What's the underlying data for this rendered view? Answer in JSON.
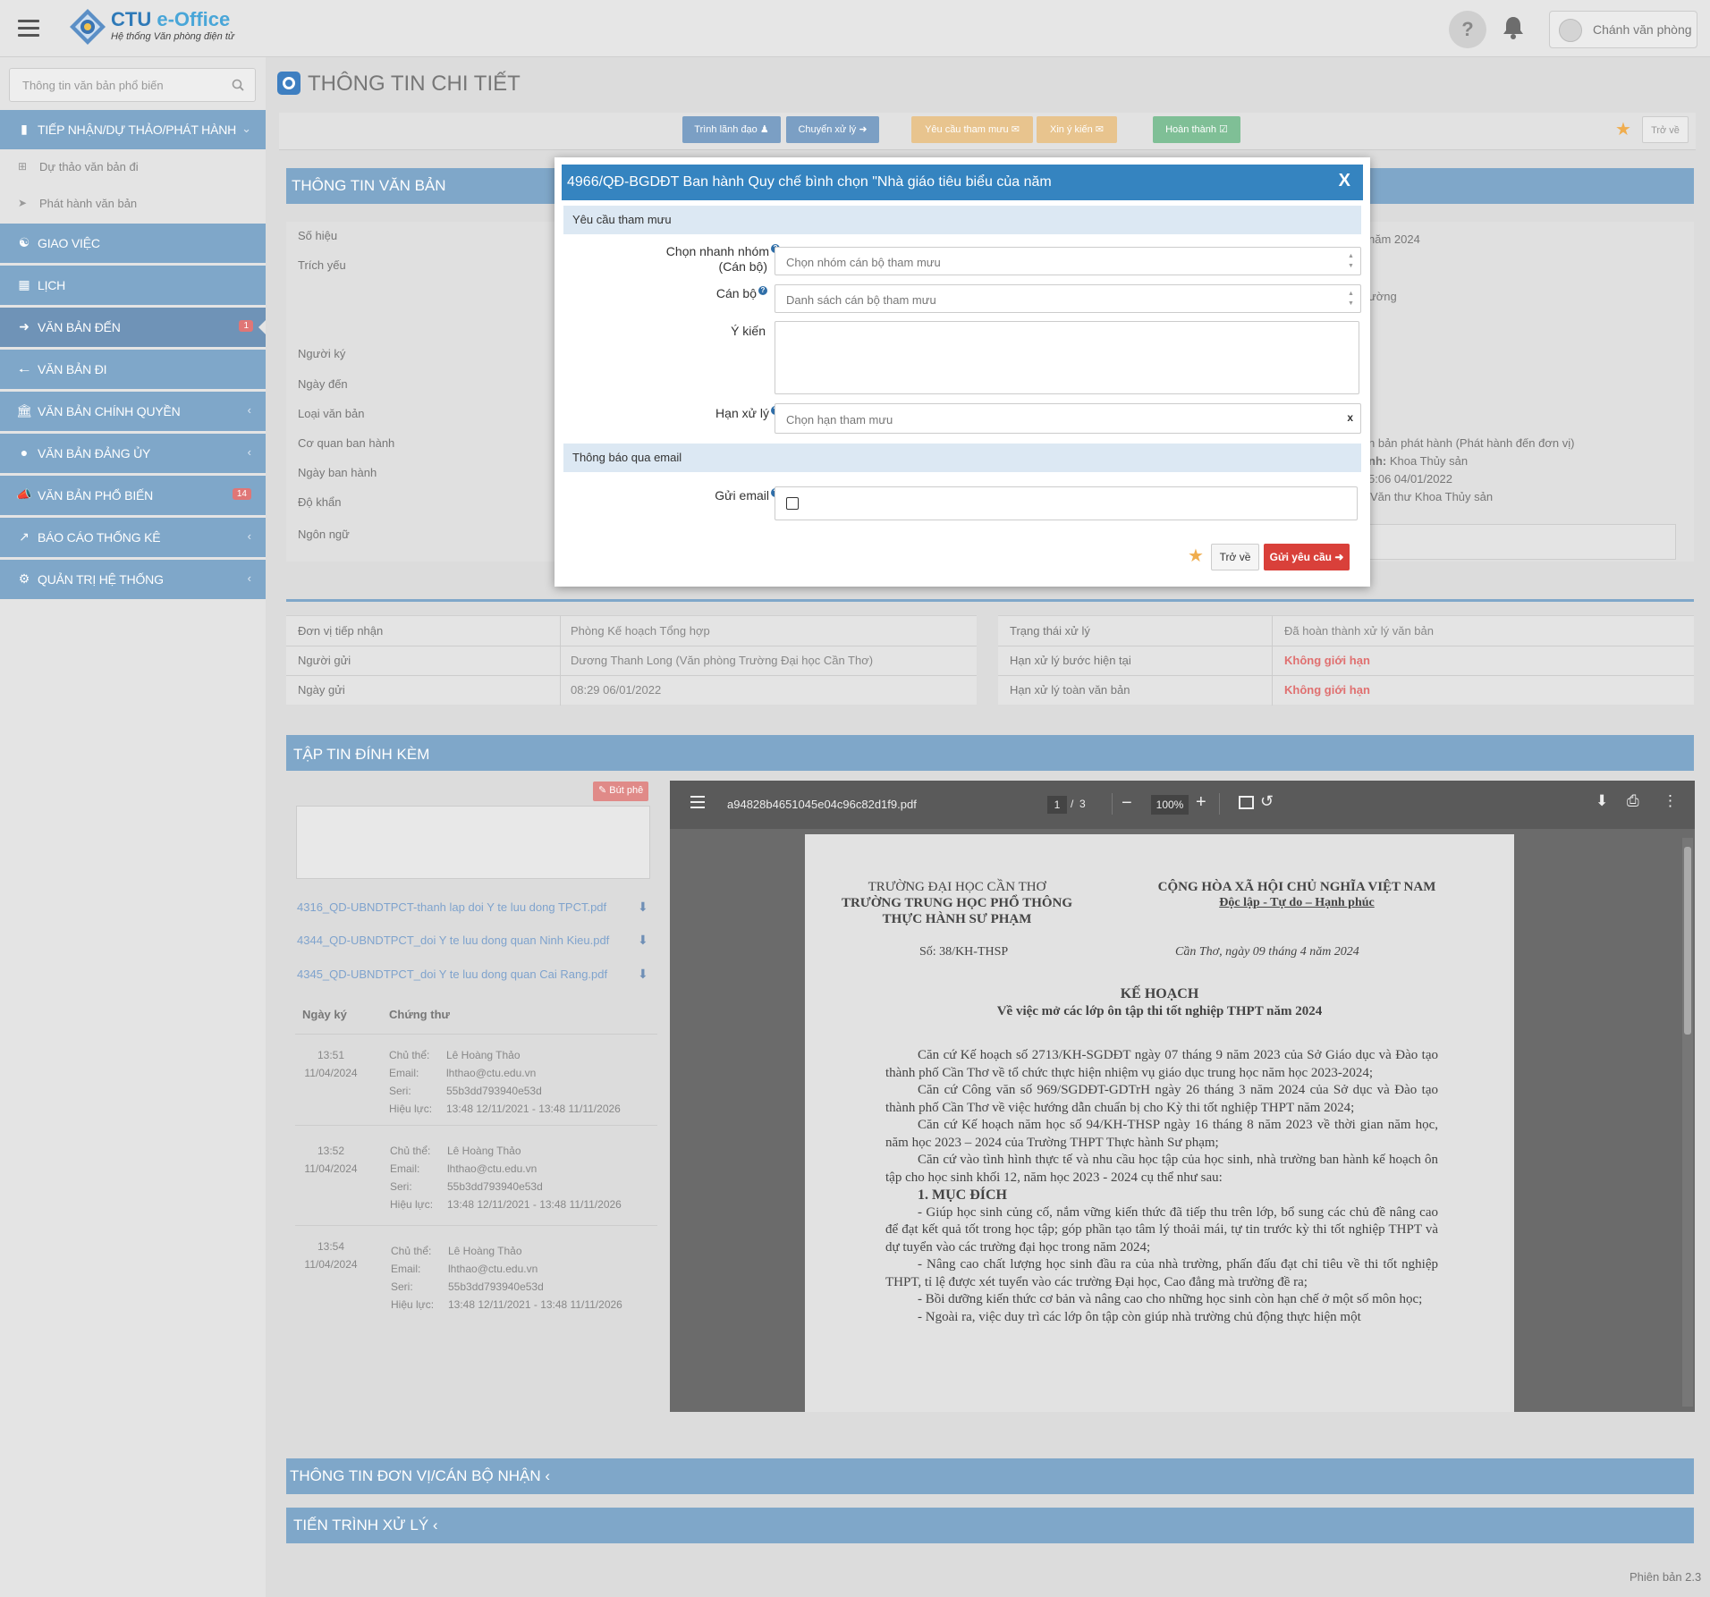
{
  "app": {
    "logo_title_a": "CTU",
    "logo_title_b": "e-Office",
    "logo_subtitle": "Hệ thống Văn phòng điện tử",
    "user_name": "Chánh văn phòng",
    "version": "Phiên bản 2.3"
  },
  "sidebar": {
    "search_placeholder": "Thông tin văn bản phổ biến",
    "menu": [
      {
        "label": "TIẾP NHẬN/DỰ THẢO/PHÁT HÀNH",
        "icon": "folder-open-icon"
      },
      {
        "label": "GIAO VIỆC",
        "icon": "handshake-icon"
      },
      {
        "label": "LỊCH",
        "icon": "calendar-icon"
      },
      {
        "label": "VĂN BẢN ĐẾN",
        "icon": "arrow-right-icon",
        "badge": "1"
      },
      {
        "label": "VĂN BẢN ĐI",
        "icon": "arrow-left-icon"
      },
      {
        "label": "VĂN BẢN CHÍNH QUYỀN",
        "icon": "bank-icon"
      },
      {
        "label": "VĂN BẢN ĐẢNG ỦY",
        "icon": "users-icon"
      },
      {
        "label": "VĂN BẢN PHỔ BIẾN",
        "icon": "bullhorn-icon",
        "badge": "14"
      },
      {
        "label": "BÁO CÁO THỐNG KÊ",
        "icon": "line-chart-icon"
      },
      {
        "label": "QUẢN TRỊ HỆ THỐNG",
        "icon": "cogs-icon"
      }
    ],
    "submenu": [
      {
        "label": "Dự thảo văn bản đi",
        "icon": "plus-square-icon"
      },
      {
        "label": "Phát hành văn bản",
        "icon": "paper-plane-icon"
      }
    ]
  },
  "page": {
    "title": "THÔNG TIN CHI TIẾT",
    "toolbar": {
      "trinh_lanh_dao": "Trình lãnh đạo",
      "chuyen_xu_ly": "Chuyển xử lý",
      "yeu_cau_tham_muu": "Yêu cầu tham mưu",
      "xin_y_kien": "Xin ý kiến",
      "hoan_thanh": "Hoàn thành",
      "tro_ve": "Trở về"
    },
    "info_section_title": "THÔNG TIN VĂN BẢN",
    "info_labels": [
      "Số hiệu",
      "Trích yếu",
      "Người ký",
      "Ngày đến",
      "Loại văn bản",
      "Cơ quan ban hành",
      "Ngày ban hành",
      "Độ khẩn",
      "Ngôn ngữ"
    ],
    "right_fragments": {
      "year": "năm 2024",
      "truong": "ường",
      "phat_hanh": "n bản phát hành (Phát hành đến đơn vị)",
      "nh_prefix": "nh:",
      "nh_value": "Khoa Thủy sản",
      "time": "5:06 04/01/2022",
      "van_thu": "Văn thư Khoa Thủy sản"
    },
    "recv_rows": [
      {
        "label": "Đơn vị tiếp nhận",
        "value": "Phòng Kế hoạch Tổng hợp"
      },
      {
        "label": "Người gửi",
        "value": "Dương Thanh Long (Văn phòng Trường Đại học Cần Thơ)"
      },
      {
        "label": "Ngày gửi",
        "value": "08:29 06/01/2022"
      }
    ],
    "status_rows": [
      {
        "label": "Trạng thái xử lý",
        "value": "Đã hoàn thành xử lý văn bản"
      },
      {
        "label": "Hạn xử lý bước hiện tại",
        "value": "Không giới hạn"
      },
      {
        "label": "Hạn xử lý toàn văn bản",
        "value": "Không giới hạn"
      }
    ],
    "attach_section_title": "TẬP TIN ĐÍNH KÈM",
    "but_phe": "Bút phê",
    "files": [
      "4316_QD-UBNDTPCT-thanh lap doi Y te luu dong TPCT.pdf",
      "4344_QD-UBNDTPCT_doi Y te luu dong quan Ninh Kieu.pdf",
      "4345_QD-UBNDTPCT_doi Y te luu dong quan Cai Rang.pdf"
    ],
    "sig_headers": {
      "date": "Ngày ký",
      "cert": "Chứng thư"
    },
    "sig_labels": {
      "subject": "Chủ thể:",
      "email": "Email:",
      "serial": "Seri:",
      "validity": "Hiệu lực:"
    },
    "signatures": [
      {
        "time": "13:51",
        "date": "11/04/2024",
        "subject": "Lê Hoàng Thảo",
        "email": "lhthao@ctu.edu.vn",
        "serial": "55b3dd793940e53d",
        "validity": "13:48 12/11/2021 - 13:48 11/11/2026"
      },
      {
        "time": "13:52",
        "date": "11/04/2024",
        "subject": "Lê Hoàng Thảo",
        "email": "lhthao@ctu.edu.vn",
        "serial": "55b3dd793940e53d",
        "validity": "13:48 12/11/2021 - 13:48 11/11/2026"
      },
      {
        "time": "13:54",
        "date": "11/04/2024",
        "subject": "Lê Hoàng Thảo",
        "email": "lhthao@ctu.edu.vn",
        "serial": "55b3dd793940e53d",
        "validity": "13:48 12/11/2021 - 13:48 11/11/2026"
      }
    ],
    "pdf": {
      "filename": "a94828b4651045e04c96c82d1f9.pdf",
      "page": "1",
      "pages_sep": "/",
      "pages": "3",
      "zoom": "100%",
      "doc": {
        "school1": "TRƯỜNG ĐẠI HỌC CẦN THƠ",
        "school2": "TRƯỜNG TRUNG HỌC PHỔ THÔNG",
        "school3": "THỰC HÀNH SƯ PHẠM",
        "nation1": "CỘNG HÒA XÃ HỘI CHỦ NGHĨA VIỆT NAM",
        "nation2": "Độc lập - Tự do – Hạnh phúc",
        "number": "Số: 38/KH-THSP",
        "place_date": "Cần Thơ, ngày 09 tháng 4 năm 2024",
        "heading": "KẾ HOẠCH",
        "subheading": "Về việc mở các lớp ôn tập thi tốt nghiệp THPT năm 2024",
        "p1": "Căn cứ Kế hoạch số 2713/KH-SGDĐT ngày 07 tháng 9 năm 2023 của Sở Giáo dục và Đào tạo thành phố Cần Thơ về tổ chức thực hiện nhiệm vụ giáo dục trung học năm học 2023-2024;",
        "p2": "Căn cứ Công văn số 969/SGDĐT-GDTrH ngày 26 tháng 3 năm 2024 của Sở dục và Đào tạo thành phố Cần Thơ về việc hướng dẫn chuẩn bị cho Kỳ thi tốt nghiệp THPT năm 2024;",
        "p3": "Căn cứ Kế hoạch năm học số 94/KH-THSP ngày 16 tháng 8 năm 2023 về thời gian năm học, năm học 2023 – 2024 của Trường THPT Thực hành Sư phạm;",
        "p4": "Căn cứ vào tình hình thực tế và nhu cầu học tập của học sinh, nhà trường ban hành kế hoạch ôn tập cho học sinh khối 12, năm học 2023 - 2024 cụ thể như sau:",
        "s1": "1. MỤC ĐÍCH",
        "b1": "- Giúp học sinh củng cố, nắm vững kiến thức đã tiếp thu trên lớp, bổ sung các chủ đề nâng cao để đạt kết quả tốt trong học tập; góp phần tạo tâm lý thoải mái, tự tin trước kỳ thi tốt nghiệp THPT và dự tuyển vào các trường đại học trong năm 2024;",
        "b2": "- Nâng cao chất lượng học sinh đầu ra của nhà trường, phấn đấu đạt chỉ tiêu về thi tốt nghiệp THPT, tỉ lệ được xét tuyển vào các trường Đại học, Cao đẳng mà trường đề ra;",
        "b3": "- Bồi dưỡng kiến thức cơ bản và nâng cao cho những học sinh còn hạn chế ở một số môn học;",
        "b4": "- Ngoài ra, việc duy trì các lớp ôn tập còn giúp nhà trường chủ động thực hiện một"
      }
    },
    "units_section_title": "THÔNG TIN ĐƠN VỊ/CÁN BỘ NHẬN",
    "process_section_title": "TIẾN TRÌNH XỬ LÝ"
  },
  "modal": {
    "title": "4966/QĐ-BGDĐT Ban hành Quy chế bình chọn \"Nhà giáo tiêu biểu của năm",
    "close": "X",
    "section1": "Yêu cầu tham mưu",
    "group_label": "Chọn nhanh nhóm",
    "group_label2": "(Cán bộ)",
    "group_placeholder": "Chọn nhóm cán bộ tham mưu",
    "staff_label": "Cán bộ",
    "staff_placeholder": "Danh sách cán bộ tham mưu",
    "opinion_label": "Ý kiến",
    "deadline_label": "Hạn xử lý",
    "deadline_placeholder": "Chọn hạn tham mưu",
    "deadline_clear": "x",
    "section2": "Thông báo qua email",
    "email_label": "Gửi email",
    "help_mark": "?",
    "back": "Trở về",
    "submit": "Gửi yêu cầu"
  },
  "colors": {
    "accent": "#3584c0",
    "section": "#7fa7c9",
    "danger": "#d9403a",
    "warning": "#f0ad4e",
    "success": "#5cb85c"
  }
}
